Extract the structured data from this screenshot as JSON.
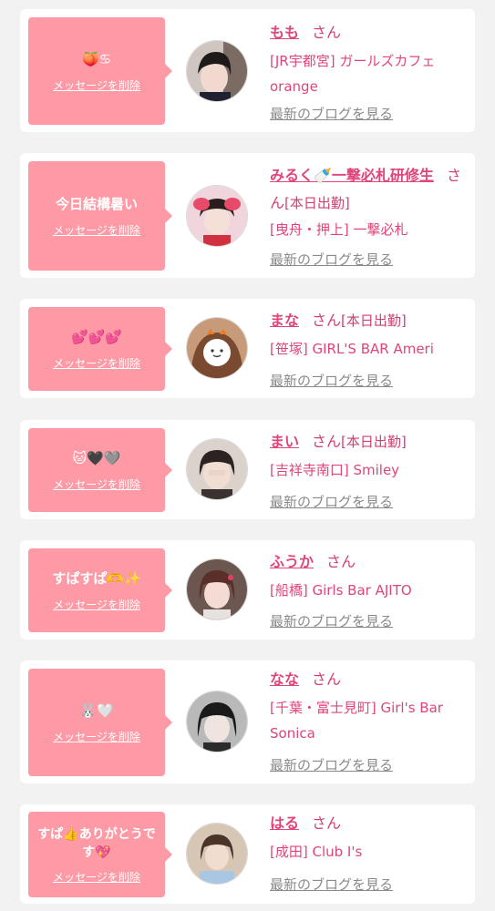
{
  "messages": [
    {
      "bubble_text": "🍑♋",
      "delete_label": "メッセージを削除",
      "name": "もも",
      "honorific": "さん",
      "status": "",
      "shop": "[JR宇都宮] ガールズカフェ orange",
      "blog_label": "最新のブログを見る"
    },
    {
      "bubble_text": "今日結構暑い",
      "delete_label": "メッセージを削除",
      "name": "みるく🍼一撃必札研修生",
      "honorific": "さん",
      "status": "[本日出勤]",
      "shop": "[曳舟・押上] 一撃必札",
      "blog_label": "最新のブログを見る"
    },
    {
      "bubble_text": "💕💕💕",
      "delete_label": "メッセージを削除",
      "name": "まな",
      "honorific": "さん",
      "status": "[本日出勤]",
      "shop": "[笹塚] GIRL'S BAR Ameri",
      "blog_label": "最新のブログを見る"
    },
    {
      "bubble_text": "🐱🖤🩶",
      "delete_label": "メッセージを削除",
      "name": "まい",
      "honorific": "さん",
      "status": "[本日出勤]",
      "shop": "[吉祥寺南口] Smiley",
      "blog_label": "最新のブログを見る"
    },
    {
      "bubble_text": "すぱすぱ🫶✨",
      "delete_label": "メッセージを削除",
      "name": "ふうか",
      "honorific": "さん",
      "status": "",
      "shop": "[船橋] Girls Bar AJITO",
      "blog_label": "最新のブログを見る"
    },
    {
      "bubble_text": "🐰🤍",
      "delete_label": "メッセージを削除",
      "name": "なな",
      "honorific": "さん",
      "status": "",
      "shop": "[千葉・富士見町] Girl's Bar Sonica",
      "blog_label": "最新のブログを見る"
    },
    {
      "bubble_text": "すぱ👍ありがとうです💖",
      "delete_label": "メッセージを削除",
      "name": "はる",
      "honorific": "さん",
      "status": "",
      "shop": "[成田] Club I's",
      "blog_label": "最新のブログを見る"
    }
  ],
  "colors": {
    "page_bg": "#f2f2f2",
    "bubble_pink": "#fd9aa5",
    "name_pink": "#e0457a",
    "link_gray": "#8a8a8a"
  }
}
